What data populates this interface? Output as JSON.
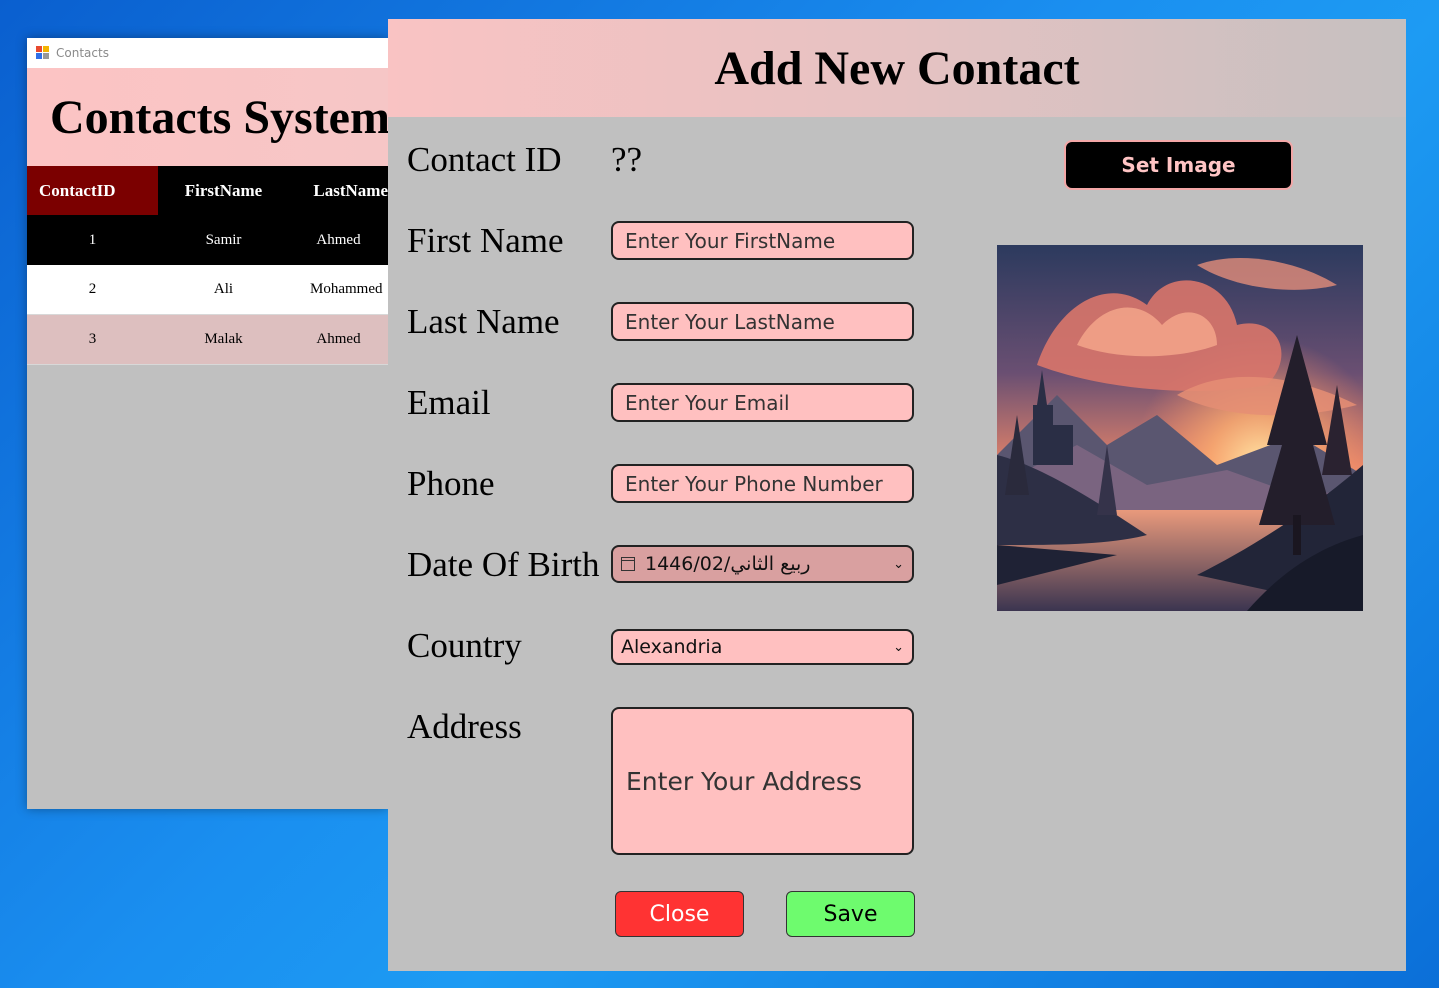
{
  "background_window": {
    "title": "Contacts",
    "header": "Contacts System",
    "columns": [
      "ContactID",
      "FirstName",
      "LastName"
    ],
    "rows": [
      [
        "1",
        "Samir",
        "Ahmed"
      ],
      [
        "2",
        "Ali",
        "Mohammed"
      ],
      [
        "3",
        "Malak",
        "Ahmed"
      ]
    ]
  },
  "dialog": {
    "title": "Add New Contact",
    "contact_id_label": "Contact ID",
    "contact_id_value": "??",
    "first_name_label": "First Name",
    "first_name_placeholder": "Enter Your FirstName",
    "last_name_label": "Last Name",
    "last_name_placeholder": "Enter Your LastName",
    "email_label": "Email",
    "email_placeholder": "Enter Your Email",
    "phone_label": "Phone",
    "phone_placeholder": "Enter Your Phone Number",
    "dob_label": "Date Of Birth",
    "dob_value": "1446/02/ربيع الثاني",
    "country_label": "Country",
    "country_value": "Alexandria",
    "address_label": "Address",
    "address_placeholder": "Enter Your Address",
    "set_image_label": "Set Image",
    "close_label": "Close",
    "save_label": "Save"
  },
  "colors": {
    "header_pink": "#fcc4c4",
    "field_pink": "#ffc0c0",
    "dob_field": "#d9a0a0",
    "form_gray": "#c0c0c0",
    "close_red": "#ff3333",
    "save_green": "#6efb6e",
    "grid_header_selected": "#7b0000",
    "row_alt": "#ddbfbf"
  }
}
